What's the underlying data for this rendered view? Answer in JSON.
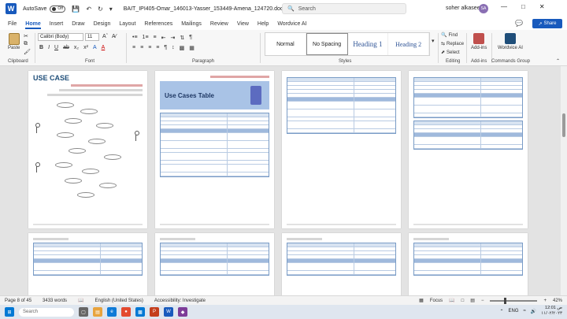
{
  "titlebar": {
    "app_icon": "W",
    "autosave_label": "AutoSave",
    "autosave_state": "Off",
    "doc_title": "BAIT_IPI405-Omar_146013-Yasser_153449-Amena_124720.docx • Saved",
    "search_placeholder": "Search",
    "user_name": "soher alkaseem",
    "avatar_initials": "SA"
  },
  "menu": {
    "tabs": [
      "File",
      "Home",
      "Insert",
      "Draw",
      "Design",
      "Layout",
      "References",
      "Mailings",
      "Review",
      "View",
      "Help",
      "Wordvice AI"
    ],
    "active": "Home",
    "share_label": "Share"
  },
  "ribbon": {
    "clipboard": {
      "paste": "Paste",
      "label": "Clipboard"
    },
    "font": {
      "name": "Calibri (Body)",
      "size": "11",
      "label": "Font",
      "buttons": [
        "B",
        "I",
        "U",
        "ab",
        "x₂",
        "x²",
        "A",
        "A"
      ]
    },
    "paragraph": {
      "label": "Paragraph",
      "buttons": [
        "≡",
        "≡",
        "≡",
        "≡",
        "¶",
        "↕"
      ]
    },
    "styles": {
      "label": "Styles",
      "items": [
        "Normal",
        "No Spacing",
        "Heading 1",
        "Heading 2"
      ],
      "selected": "No Spacing"
    },
    "editing": {
      "label": "Editing",
      "find": "Find",
      "replace": "Replace",
      "select": "Select"
    },
    "addins": {
      "label": "Add-ins",
      "button": "Add-ins"
    },
    "wordvice": {
      "label": "Commands Group",
      "button": "Wordvice AI"
    }
  },
  "pages": {
    "p1_title": "USE CASE",
    "p2_banner": "Use Cases Table"
  },
  "statusbar": {
    "page": "Page 8 of 45",
    "words": "3433 words",
    "language": "English (United States)",
    "accessibility": "Accessibility: Investigate",
    "focus": "Focus",
    "zoom": "42%"
  },
  "taskbar": {
    "search": "Search",
    "lang": "ENG",
    "time": "12:01 ص",
    "date": "١١/٠٢/٢٠٢٣"
  },
  "colors": {
    "accent": "#185abd",
    "table_header": "#d7e3f1",
    "table_border": "#7a9cc6"
  }
}
